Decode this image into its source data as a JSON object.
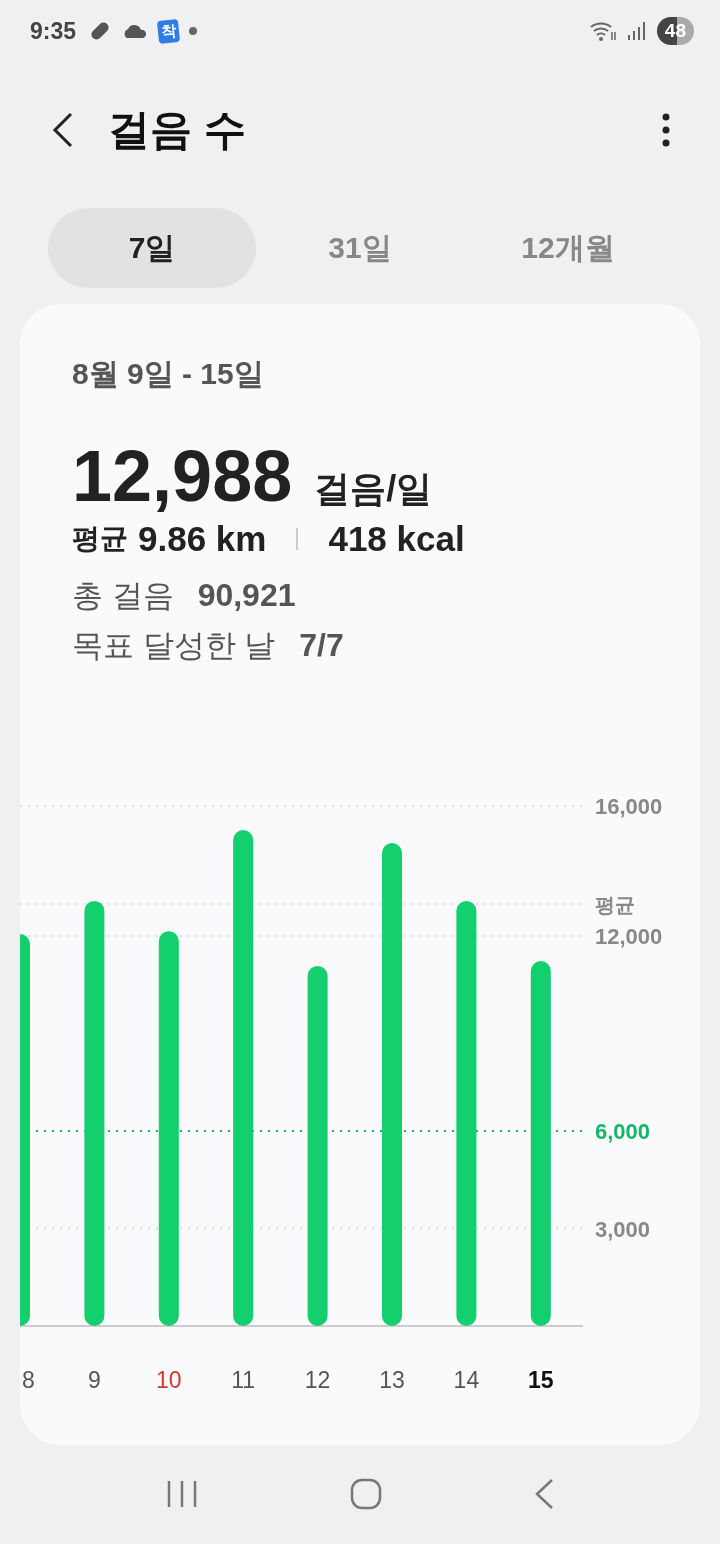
{
  "status_bar": {
    "time": "9:35",
    "app_badge": "착",
    "battery": "48"
  },
  "header": {
    "title": "걸음 수"
  },
  "tabs": [
    {
      "label": "7일",
      "selected": true
    },
    {
      "label": "31일",
      "selected": false
    },
    {
      "label": "12개월",
      "selected": false
    }
  ],
  "summary": {
    "date_range": "8월 9일 - 15일",
    "daily_steps": "12,988",
    "daily_unit": "걸음/일",
    "avg_label": "평균",
    "distance": "9.86 km",
    "calories": "418 kcal",
    "stats": [
      {
        "label": "총 걸음",
        "value": "90,921"
      },
      {
        "label": "목표 달성한 날",
        "value": "7/7"
      }
    ]
  },
  "chart_data": {
    "type": "bar",
    "categories": [
      "8",
      "9",
      "10",
      "11",
      "12",
      "13",
      "14",
      "15"
    ],
    "values": [
      12060,
      13080,
      12150,
      15260,
      11080,
      14860,
      13080,
      11230
    ],
    "ylim": [
      0,
      16000
    ],
    "yticks": [
      {
        "value": 3000,
        "label": "3,000"
      },
      {
        "value": 6000,
        "label": "6,000"
      },
      {
        "value": 12000,
        "label": "12,000"
      },
      {
        "value": 16000,
        "label": "16,000"
      }
    ],
    "grid": true,
    "ref_lines": [
      {
        "axis": "y",
        "value": 6000,
        "color": "#12b866"
      },
      {
        "axis": "y",
        "value": 12988,
        "label": "평균",
        "color": "#dddddd"
      }
    ]
  },
  "day_labels": [
    {
      "sunday": false,
      "today": false
    },
    {
      "sunday": false,
      "today": false
    },
    {
      "sunday": true,
      "today": false
    },
    {
      "sunday": false,
      "today": false
    },
    {
      "sunday": false,
      "today": false
    },
    {
      "sunday": false,
      "today": false
    },
    {
      "sunday": false,
      "today": false
    },
    {
      "sunday": false,
      "today": true
    }
  ]
}
